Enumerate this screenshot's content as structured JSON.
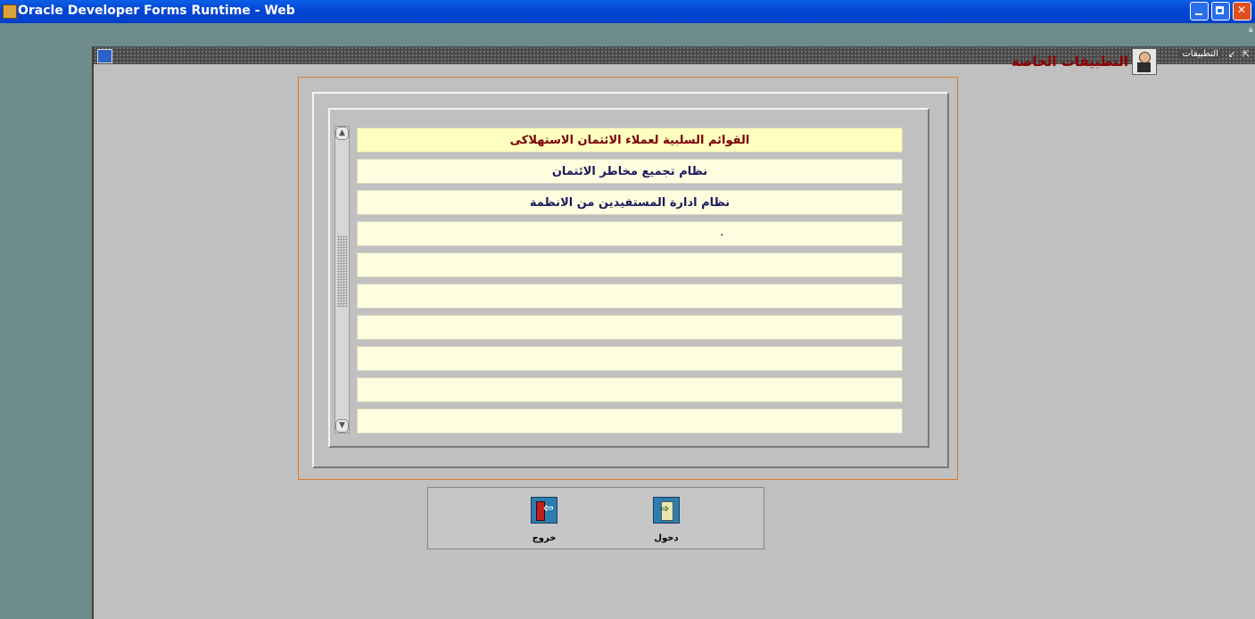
{
  "window": {
    "title": "Oracle Developer Forms Runtime - Web"
  },
  "menu": {
    "item": "ة"
  },
  "inner_window": {
    "caption": "التطبيقات"
  },
  "heading": {
    "text": "التطبيقات الخاصة"
  },
  "applications": [
    {
      "label": "القوائم السلبية لعملاء الائتمان الاستهلاكى",
      "selected": true
    },
    {
      "label": "نظام تجميع مخاطر الائتمان"
    },
    {
      "label": "نظام ادارة المستفيدين من الانظمة"
    },
    {
      "label": "."
    },
    {
      "label": ""
    },
    {
      "label": ""
    },
    {
      "label": ""
    },
    {
      "label": ""
    },
    {
      "label": ""
    },
    {
      "label": ""
    }
  ],
  "buttons": {
    "exit_label": "خروج",
    "enter_label": "دخول"
  },
  "colors": {
    "background": "#6e8c8c",
    "panel": "#c0c0c0",
    "row": "#fffde0",
    "heading": "#8b0000",
    "frame": "#e07a28"
  },
  "icons": {
    "app": "oracle-forms-icon",
    "heading": "user-icon",
    "exit": "exit-door-icon",
    "enter": "enter-door-icon"
  }
}
